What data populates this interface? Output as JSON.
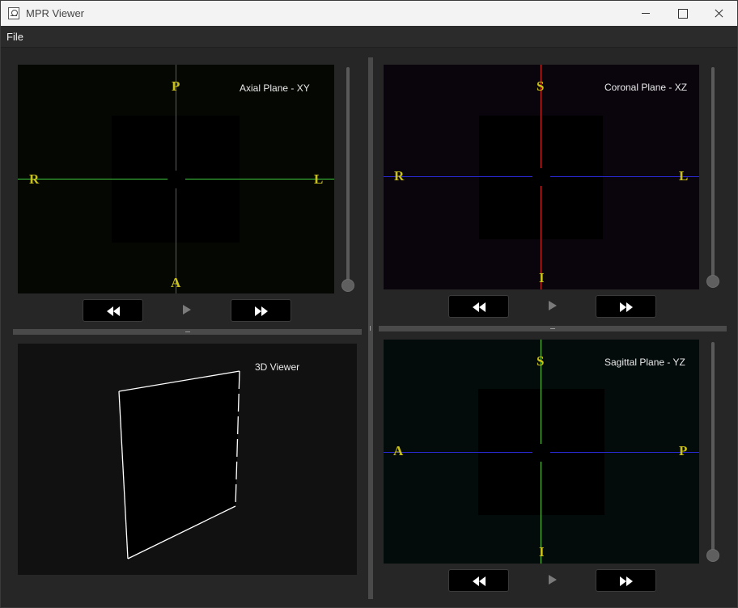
{
  "window": {
    "title": "MPR Viewer",
    "app_icon": "mpr-app-icon",
    "controls": [
      "minimize-icon",
      "maximize-icon",
      "close-icon"
    ]
  },
  "menu": {
    "items": [
      {
        "label": "File"
      }
    ]
  },
  "views": {
    "axial": {
      "title": "Axial Plane - XY",
      "top": "P",
      "bottom": "A",
      "left": "R",
      "right": "L",
      "vline_color": "#d42a2a",
      "hline_color": "#3fcf3f",
      "bg": "#050702"
    },
    "coronal": {
      "title": "Coronal Plane - XZ",
      "top": "S",
      "bottom": "I",
      "left": "R",
      "right": "L",
      "vline_color": "#d42a2a",
      "hline_color": "#2a2ad4",
      "bg": "#0a050d"
    },
    "sagittal": {
      "title": "Sagittal Plane - YZ",
      "top": "S",
      "bottom": "I",
      "left": "A",
      "right": "P",
      "vline_color": "#5fcf3f",
      "hline_color": "#2a2ad4",
      "bg": "#040b0b"
    },
    "viewer3d": {
      "title": "3D Viewer",
      "bg": "#111111"
    }
  },
  "playback": {
    "rewind_icon": "rewind-icon",
    "play_icon": "play-icon",
    "forward_icon": "fast-forward-icon"
  },
  "colors": {
    "orientation_label": "#c9c11a",
    "plane_label": "#eaeaea"
  }
}
